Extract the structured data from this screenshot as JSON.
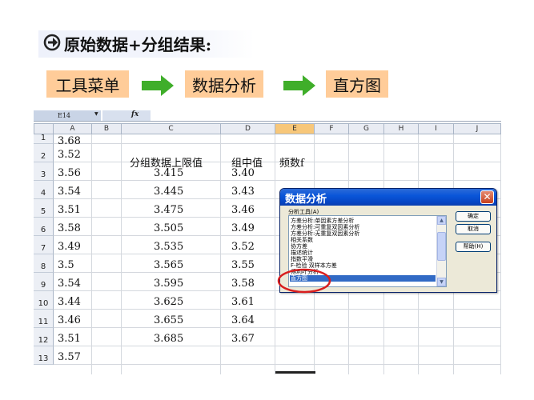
{
  "slide": {
    "title": "原始数据+分组结果:",
    "flow": [
      "工具菜单",
      "数据分析",
      "直方图"
    ]
  },
  "sheet": {
    "name_box": "E14",
    "fx_label": "fx",
    "columns": [
      "A",
      "B",
      "C",
      "D",
      "E",
      "F",
      "G",
      "H",
      "I",
      "J"
    ],
    "active_column": "E",
    "row_numbers": [
      "1",
      "2",
      "3",
      "4",
      "5",
      "6",
      "7",
      "8",
      "9",
      "10",
      "11",
      "12",
      "13"
    ],
    "column_a": [
      "3.68",
      "3.52",
      "3.56",
      "3.54",
      "3.51",
      "3.58",
      "3.49",
      "3.5",
      "3.54",
      "3.44",
      "3.46",
      "3.51",
      "3.57"
    ],
    "headers": {
      "c": "分组数据上限值",
      "d": "组中值",
      "e": "频数f"
    },
    "column_c": [
      "3.415",
      "3.445",
      "3.475",
      "3.505",
      "3.535",
      "3.565",
      "3.595",
      "3.625",
      "3.655",
      "3.685"
    ],
    "column_d": [
      "3.40",
      "3.43",
      "3.46",
      "3.49",
      "3.52",
      "3.55",
      "3.58",
      "3.61",
      "3.64",
      "3.67"
    ]
  },
  "dialog": {
    "title": "数据分析",
    "close_label": "✕",
    "tools_label": "分析工具(A)",
    "tools": [
      "方差分析:单因素方差分析",
      "方差分析:可重复双因素分析",
      "方差分析:无重复双因素分析",
      "相关系数",
      "协方差",
      "描述统计",
      "指数平滑",
      "F-检验 双样本方差",
      "傅利叶分析",
      "直方图"
    ],
    "selected_tool": "直方图",
    "buttons": {
      "ok": "确定",
      "cancel": "取消",
      "help": "帮助(H)"
    }
  },
  "colors": {
    "flow_box": "#ffcc99",
    "flow_arrow": "#3fae2a",
    "dialog_title": "#0a56d9",
    "highlight_ellipse": "#d81e1e",
    "active_column": "#f7c77a"
  }
}
